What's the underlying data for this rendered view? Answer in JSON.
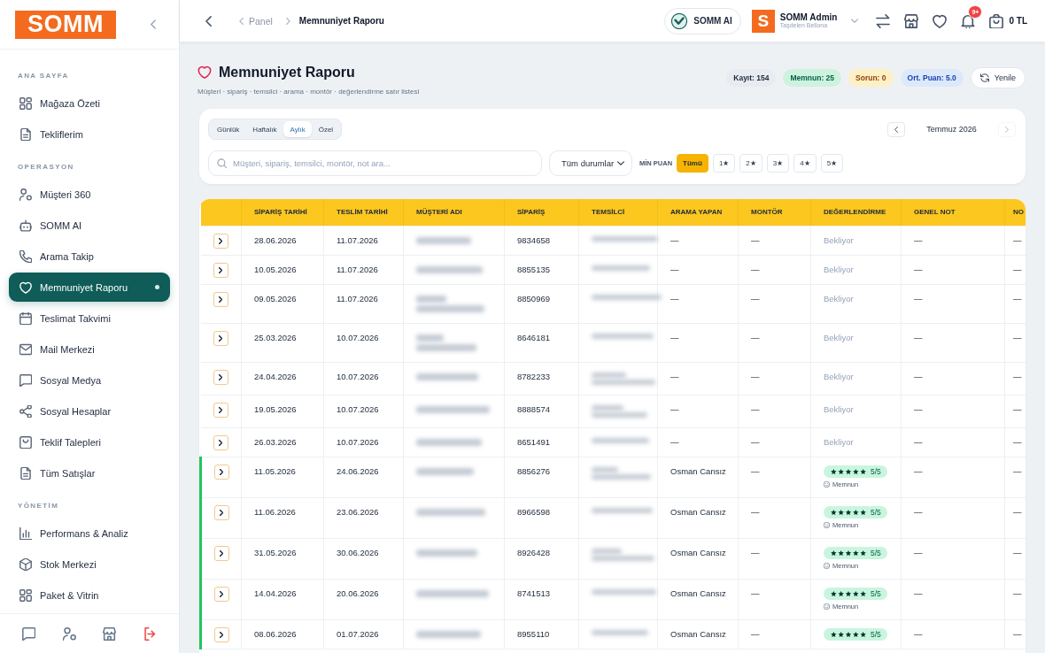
{
  "sidebar": {
    "logo": "SOMM",
    "sections": [
      {
        "title": "ANA SAYFA",
        "items": [
          {
            "label": "Mağaza Özeti",
            "selected": false
          },
          {
            "label": "Tekliflerim",
            "selected": false
          }
        ]
      },
      {
        "title": "OPERASYON",
        "items": [
          {
            "label": "Müşteri 360",
            "selected": false
          },
          {
            "label": "SOMM AI",
            "selected": false
          },
          {
            "label": "Arama Takip",
            "selected": false
          },
          {
            "label": "Memnuniyet Raporu",
            "selected": true
          },
          {
            "label": "Teslimat Takvimi",
            "selected": false
          },
          {
            "label": "Mail Merkezi",
            "selected": false
          },
          {
            "label": "Sosyal Medya",
            "selected": false
          },
          {
            "label": "Sosyal Hesaplar",
            "selected": false
          },
          {
            "label": "Teklif Talepleri",
            "selected": false
          },
          {
            "label": "Tüm Satışlar",
            "selected": false
          }
        ]
      },
      {
        "title": "YÖNETİM",
        "items": [
          {
            "label": "Performans & Analiz",
            "selected": false
          },
          {
            "label": "Stok Merkezi",
            "selected": false
          },
          {
            "label": "Paket & Vitrin",
            "selected": false
          }
        ]
      }
    ]
  },
  "topbar": {
    "breadcrumb": [
      {
        "label": "Panel",
        "current": false
      },
      {
        "label": "Memnuniyet Raporu",
        "current": true
      }
    ],
    "assistant_button": "SOMM AI",
    "user": {
      "avatar": "S",
      "name": "SOMM Admin",
      "store": "Taşdelen Bellona"
    },
    "notification_badge": "9+",
    "cart_total": "0 TL"
  },
  "page": {
    "title": "Memnuniyet Raporu",
    "subtitle": "Müşteri · sipariş · temsilci · arama · montör · değerlendirme satır listesi",
    "stats": [
      {
        "label": "Kayıt: 154",
        "kind": "neutral"
      },
      {
        "label": "Memnun: 25",
        "kind": "success"
      },
      {
        "label": "Sorun: 0",
        "kind": "warning"
      },
      {
        "label": "Ort. Puan: 5.0",
        "kind": "info"
      }
    ],
    "refresh_button": "Yenile"
  },
  "filters": {
    "periods": [
      {
        "label": "Günlük",
        "selected": false
      },
      {
        "label": "Haftalık",
        "selected": false
      },
      {
        "label": "Aylık",
        "selected": true
      },
      {
        "label": "Özel",
        "selected": false
      }
    ],
    "month_nav": {
      "label": "Temmuz 2026",
      "previous_disabled": false,
      "next_disabled": true
    },
    "search": {
      "placeholder": "Müşteri, sipariş, temsilci, montör, not ara..."
    },
    "status_select": "Tüm durumlar",
    "min_score": {
      "label": "MİN PUAN",
      "options": [
        {
          "label": "Tümü",
          "selected": true
        },
        {
          "label": "1★",
          "selected": false
        },
        {
          "label": "2★",
          "selected": false
        },
        {
          "label": "3★",
          "selected": false
        },
        {
          "label": "4★",
          "selected": false
        },
        {
          "label": "5★",
          "selected": false
        }
      ]
    }
  },
  "table": {
    "columns": [
      "SİPARİŞ TARİHİ",
      "TESLİM TARİHİ",
      "MÜŞTERİ ADI",
      "SİPARİŞ",
      "TEMSİLCİ",
      "ARAMA YAPAN",
      "MONTÖR",
      "DEĞERLENDİRME",
      "GENEL NOT",
      "NO"
    ],
    "rows": [
      {
        "order_date": "28.06.2026",
        "delivery_date": "11.07.2026",
        "customer": {
          "kind": "blurred",
          "wrapped": false
        },
        "order": "9834658",
        "representative": {
          "kind": "blurred",
          "wrapped": false
        },
        "caller": "—",
        "installer": "—",
        "evaluation": {
          "kind": "pending",
          "text": "Bekliyor"
        },
        "general_note": "—",
        "column_11": "—"
      },
      {
        "order_date": "10.05.2026",
        "delivery_date": "11.07.2026",
        "customer": {
          "kind": "blurred",
          "wrapped": false
        },
        "order": "8855135",
        "representative": {
          "kind": "blurred",
          "wrapped": false
        },
        "caller": "—",
        "installer": "—",
        "evaluation": {
          "kind": "pending",
          "text": "Bekliyor"
        },
        "general_note": "—",
        "column_11": "—"
      },
      {
        "order_date": "09.05.2026",
        "delivery_date": "11.07.2026",
        "customer": {
          "kind": "blurred",
          "wrapped": true
        },
        "order": "8850969",
        "representative": {
          "kind": "blurred",
          "wrapped": false
        },
        "caller": "—",
        "installer": "—",
        "evaluation": {
          "kind": "pending",
          "text": "Bekliyor"
        },
        "general_note": "—",
        "column_11": "—"
      },
      {
        "order_date": "25.03.2026",
        "delivery_date": "10.07.2026",
        "customer": {
          "kind": "blurred",
          "wrapped": true
        },
        "order": "8646181",
        "representative": {
          "kind": "blurred",
          "wrapped": false
        },
        "caller": "—",
        "installer": "—",
        "evaluation": {
          "kind": "pending",
          "text": "Bekliyor"
        },
        "general_note": "—",
        "column_11": "—"
      },
      {
        "order_date": "24.04.2026",
        "delivery_date": "10.07.2026",
        "customer": {
          "kind": "blurred",
          "wrapped": false
        },
        "order": "8782233",
        "representative": {
          "kind": "blurred",
          "wrapped": true
        },
        "caller": "—",
        "installer": "—",
        "evaluation": {
          "kind": "pending",
          "text": "Bekliyor"
        },
        "general_note": "—",
        "column_11": "—"
      },
      {
        "order_date": "19.05.2026",
        "delivery_date": "10.07.2026",
        "customer": {
          "kind": "blurred",
          "wrapped": false
        },
        "order": "8888574",
        "representative": {
          "kind": "blurred",
          "wrapped": true
        },
        "caller": "—",
        "installer": "—",
        "evaluation": {
          "kind": "pending",
          "text": "Bekliyor"
        },
        "general_note": "—",
        "column_11": "—"
      },
      {
        "order_date": "26.03.2026",
        "delivery_date": "10.07.2026",
        "customer": {
          "kind": "blurred",
          "wrapped": false
        },
        "order": "8651491",
        "representative": {
          "kind": "blurred",
          "wrapped": false
        },
        "caller": "—",
        "installer": "—",
        "evaluation": {
          "kind": "pending",
          "text": "Bekliyor"
        },
        "general_note": "—",
        "column_11": "—"
      },
      {
        "order_date": "11.05.2026",
        "delivery_date": "24.06.2026",
        "customer": {
          "kind": "blurred",
          "wrapped": false
        },
        "order": "8856276",
        "representative": {
          "kind": "blurred",
          "wrapped": true
        },
        "caller": "Osman Cansız",
        "installer": "—",
        "evaluation": {
          "kind": "rated",
          "stars": 5,
          "score": "5/5",
          "label": "Memnun"
        },
        "general_note": "—",
        "column_11": "—"
      },
      {
        "order_date": "11.06.2026",
        "delivery_date": "23.06.2026",
        "customer": {
          "kind": "blurred",
          "wrapped": false
        },
        "order": "8966598",
        "representative": {
          "kind": "blurred",
          "wrapped": false
        },
        "caller": "Osman Cansız",
        "installer": "—",
        "evaluation": {
          "kind": "rated",
          "stars": 5,
          "score": "5/5",
          "label": "Memnun"
        },
        "general_note": "—",
        "column_11": "—"
      },
      {
        "order_date": "31.05.2026",
        "delivery_date": "30.06.2026",
        "customer": {
          "kind": "blurred",
          "wrapped": false
        },
        "order": "8926428",
        "representative": {
          "kind": "blurred",
          "wrapped": true
        },
        "caller": "Osman Cansız",
        "installer": "—",
        "evaluation": {
          "kind": "rated",
          "stars": 5,
          "score": "5/5",
          "label": "Memnun"
        },
        "general_note": "—",
        "column_11": "—"
      },
      {
        "order_date": "14.04.2026",
        "delivery_date": "20.06.2026",
        "customer": {
          "kind": "blurred",
          "wrapped": false
        },
        "order": "8741513",
        "representative": {
          "kind": "blurred",
          "wrapped": false
        },
        "caller": "Osman Cansız",
        "installer": "—",
        "evaluation": {
          "kind": "rated",
          "stars": 5,
          "score": "5/5",
          "label": "Memnun"
        },
        "general_note": "—",
        "column_11": "—"
      },
      {
        "order_date": "08.06.2026",
        "delivery_date": "01.07.2026",
        "customer": {
          "kind": "blurred",
          "wrapped": false
        },
        "order": "8955110",
        "representative": {
          "kind": "blurred",
          "wrapped": false
        },
        "caller": "Osman Cansız",
        "installer": "—",
        "evaluation": {
          "kind": "rated",
          "stars": 5,
          "score": "5/5"
        },
        "general_note": "—",
        "column_11": "—"
      }
    ]
  }
}
